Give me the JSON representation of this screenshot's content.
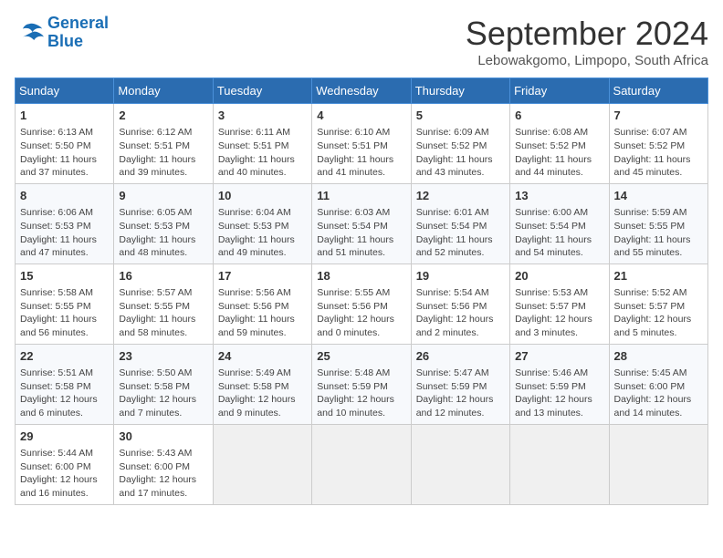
{
  "header": {
    "logo_line1": "General",
    "logo_line2": "Blue",
    "month": "September 2024",
    "location": "Lebowakgomo, Limpopo, South Africa"
  },
  "days_of_week": [
    "Sunday",
    "Monday",
    "Tuesday",
    "Wednesday",
    "Thursday",
    "Friday",
    "Saturday"
  ],
  "weeks": [
    [
      {
        "day": "1",
        "info": "Sunrise: 6:13 AM\nSunset: 5:50 PM\nDaylight: 11 hours\nand 37 minutes."
      },
      {
        "day": "2",
        "info": "Sunrise: 6:12 AM\nSunset: 5:51 PM\nDaylight: 11 hours\nand 39 minutes."
      },
      {
        "day": "3",
        "info": "Sunrise: 6:11 AM\nSunset: 5:51 PM\nDaylight: 11 hours\nand 40 minutes."
      },
      {
        "day": "4",
        "info": "Sunrise: 6:10 AM\nSunset: 5:51 PM\nDaylight: 11 hours\nand 41 minutes."
      },
      {
        "day": "5",
        "info": "Sunrise: 6:09 AM\nSunset: 5:52 PM\nDaylight: 11 hours\nand 43 minutes."
      },
      {
        "day": "6",
        "info": "Sunrise: 6:08 AM\nSunset: 5:52 PM\nDaylight: 11 hours\nand 44 minutes."
      },
      {
        "day": "7",
        "info": "Sunrise: 6:07 AM\nSunset: 5:52 PM\nDaylight: 11 hours\nand 45 minutes."
      }
    ],
    [
      {
        "day": "8",
        "info": "Sunrise: 6:06 AM\nSunset: 5:53 PM\nDaylight: 11 hours\nand 47 minutes."
      },
      {
        "day": "9",
        "info": "Sunrise: 6:05 AM\nSunset: 5:53 PM\nDaylight: 11 hours\nand 48 minutes."
      },
      {
        "day": "10",
        "info": "Sunrise: 6:04 AM\nSunset: 5:53 PM\nDaylight: 11 hours\nand 49 minutes."
      },
      {
        "day": "11",
        "info": "Sunrise: 6:03 AM\nSunset: 5:54 PM\nDaylight: 11 hours\nand 51 minutes."
      },
      {
        "day": "12",
        "info": "Sunrise: 6:01 AM\nSunset: 5:54 PM\nDaylight: 11 hours\nand 52 minutes."
      },
      {
        "day": "13",
        "info": "Sunrise: 6:00 AM\nSunset: 5:54 PM\nDaylight: 11 hours\nand 54 minutes."
      },
      {
        "day": "14",
        "info": "Sunrise: 5:59 AM\nSunset: 5:55 PM\nDaylight: 11 hours\nand 55 minutes."
      }
    ],
    [
      {
        "day": "15",
        "info": "Sunrise: 5:58 AM\nSunset: 5:55 PM\nDaylight: 11 hours\nand 56 minutes."
      },
      {
        "day": "16",
        "info": "Sunrise: 5:57 AM\nSunset: 5:55 PM\nDaylight: 11 hours\nand 58 minutes."
      },
      {
        "day": "17",
        "info": "Sunrise: 5:56 AM\nSunset: 5:56 PM\nDaylight: 11 hours\nand 59 minutes."
      },
      {
        "day": "18",
        "info": "Sunrise: 5:55 AM\nSunset: 5:56 PM\nDaylight: 12 hours\nand 0 minutes."
      },
      {
        "day": "19",
        "info": "Sunrise: 5:54 AM\nSunset: 5:56 PM\nDaylight: 12 hours\nand 2 minutes."
      },
      {
        "day": "20",
        "info": "Sunrise: 5:53 AM\nSunset: 5:57 PM\nDaylight: 12 hours\nand 3 minutes."
      },
      {
        "day": "21",
        "info": "Sunrise: 5:52 AM\nSunset: 5:57 PM\nDaylight: 12 hours\nand 5 minutes."
      }
    ],
    [
      {
        "day": "22",
        "info": "Sunrise: 5:51 AM\nSunset: 5:58 PM\nDaylight: 12 hours\nand 6 minutes."
      },
      {
        "day": "23",
        "info": "Sunrise: 5:50 AM\nSunset: 5:58 PM\nDaylight: 12 hours\nand 7 minutes."
      },
      {
        "day": "24",
        "info": "Sunrise: 5:49 AM\nSunset: 5:58 PM\nDaylight: 12 hours\nand 9 minutes."
      },
      {
        "day": "25",
        "info": "Sunrise: 5:48 AM\nSunset: 5:59 PM\nDaylight: 12 hours\nand 10 minutes."
      },
      {
        "day": "26",
        "info": "Sunrise: 5:47 AM\nSunset: 5:59 PM\nDaylight: 12 hours\nand 12 minutes."
      },
      {
        "day": "27",
        "info": "Sunrise: 5:46 AM\nSunset: 5:59 PM\nDaylight: 12 hours\nand 13 minutes."
      },
      {
        "day": "28",
        "info": "Sunrise: 5:45 AM\nSunset: 6:00 PM\nDaylight: 12 hours\nand 14 minutes."
      }
    ],
    [
      {
        "day": "29",
        "info": "Sunrise: 5:44 AM\nSunset: 6:00 PM\nDaylight: 12 hours\nand 16 minutes."
      },
      {
        "day": "30",
        "info": "Sunrise: 5:43 AM\nSunset: 6:00 PM\nDaylight: 12 hours\nand 17 minutes."
      },
      {
        "day": "",
        "info": ""
      },
      {
        "day": "",
        "info": ""
      },
      {
        "day": "",
        "info": ""
      },
      {
        "day": "",
        "info": ""
      },
      {
        "day": "",
        "info": ""
      }
    ]
  ]
}
